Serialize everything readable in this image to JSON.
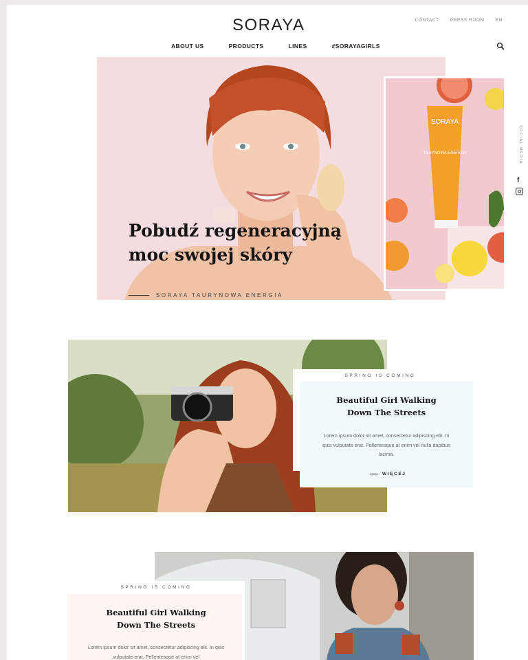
{
  "header": {
    "logo": "SORAYA",
    "utility": [
      "CONTACT",
      "PRESS ROOM",
      "EN"
    ],
    "nav": [
      "ABOUT US",
      "PRODUCTS",
      "LINES",
      "#SORAYAGIRLS"
    ]
  },
  "hero": {
    "title_line1": "Pobudź regeneracyjną",
    "title_line2": "moc swojej skóry",
    "subtitle": "SORAYA TAURYNOWA ENERGIA",
    "product_brand": "SORAYA",
    "product_line": "TaurYNOWA ENERGIA"
  },
  "social": {
    "label": "SOCIAL MEDIA"
  },
  "article1": {
    "kicker": "SPRING IS COMING",
    "title": "Beautiful Girl Walking Down The Streets",
    "body": "Lorem ipsum dolor sit amet, consectetur adipiscing elit. In quis vulputate erat. Pellentesque at enim vel nulla dapibus lacinia.",
    "more": "WIĘCEJ"
  },
  "article2": {
    "kicker": "SPRING IS COMING",
    "title": "Beautiful Girl Walking Down The Streets",
    "body": "Lorem ipsum dolor sit amet, consectetur adipiscing elit. In quis vulputate erat. Pellentesque at enim vel"
  },
  "colors": {
    "hero_bg": "#f5dcdf",
    "product_bg": "#f2c9ce",
    "card_blue": "#f1fafd",
    "card_peach": "#fdf6f2",
    "accent_orange": "#f3a02a"
  }
}
